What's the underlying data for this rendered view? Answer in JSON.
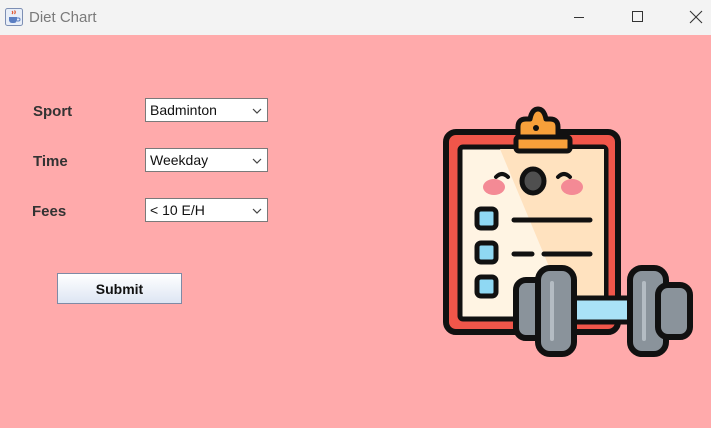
{
  "window": {
    "title": "Diet Chart",
    "icon": "java-cup-icon",
    "controls": [
      "minimize-icon",
      "maximize-icon",
      "close-icon"
    ]
  },
  "form": {
    "sport": {
      "label": "Sport",
      "value": "Badminton"
    },
    "time": {
      "label": "Time",
      "value": "Weekday"
    },
    "fees": {
      "label": "Fees",
      "value": "< 10 E/H"
    },
    "submit_label": "Submit"
  },
  "illustration": {
    "icon": "clipboard-dumbbell-icon"
  },
  "colors": {
    "background": "#ffaaab",
    "titlebar": "#f3f3f3",
    "clipboard_red": "#f0564a",
    "clip_orange": "#f7a03a",
    "checkbox_blue": "#8fd8f3",
    "dumbbell_gray": "#8a939b"
  }
}
